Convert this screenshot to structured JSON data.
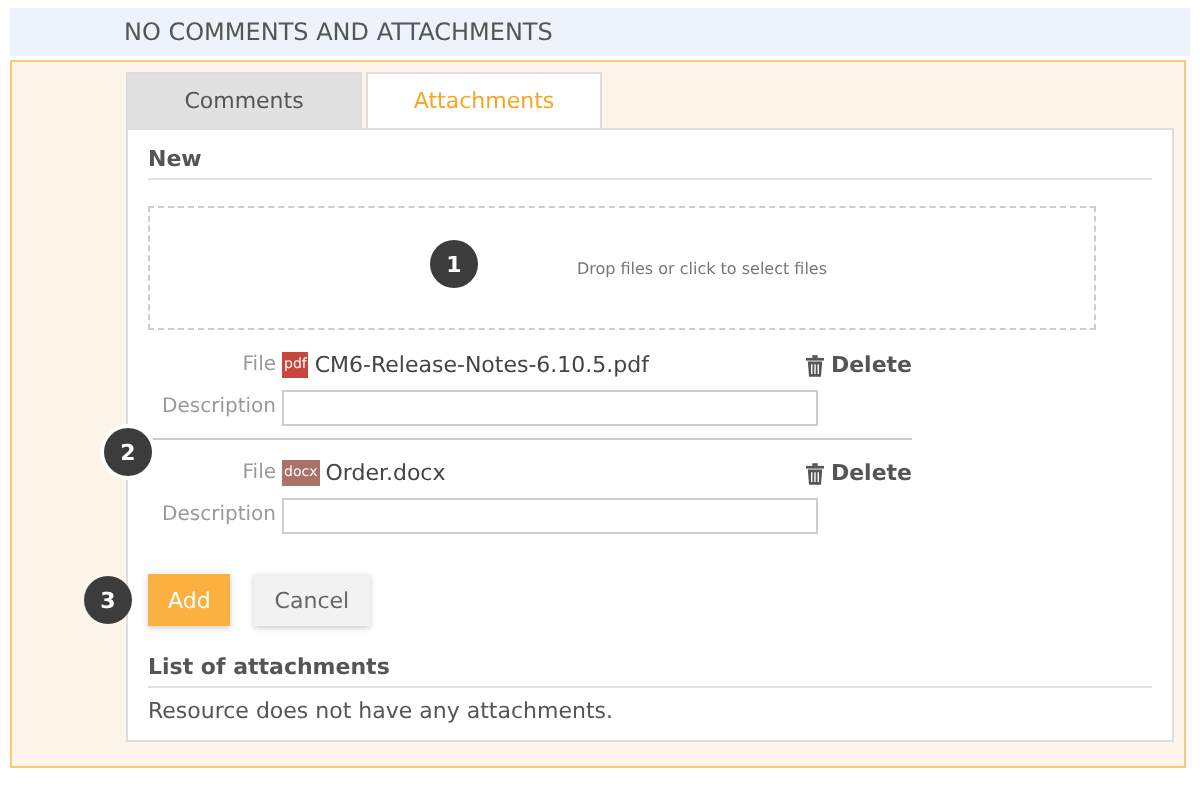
{
  "header": {
    "title": "NO COMMENTS AND ATTACHMENTS"
  },
  "tabs": [
    {
      "label": "Comments",
      "selected": false
    },
    {
      "label": "Attachments",
      "selected": true
    }
  ],
  "new_section": {
    "heading": "New",
    "dropzone": {
      "callout": "1",
      "text": "Drop files or click to select files"
    },
    "files_callout": "2",
    "files": [
      {
        "file_label": "File",
        "icon_label": "pdf",
        "color": "#c9463d",
        "name": "CM6-Release-Notes-6.10.5.pdf",
        "delete": "Delete",
        "description_label": "Description"
      },
      {
        "file_label": "File",
        "icon_label": "docx",
        "color": "#a87268",
        "name": "Order.docx",
        "delete": "Delete",
        "description_label": "Description"
      }
    ],
    "buttons_callout": "3",
    "buttons": [
      {
        "label": "Add",
        "kind": "primary"
      },
      {
        "label": "Cancel",
        "kind": "secondary"
      }
    ]
  },
  "list_section": {
    "heading": "List of attachments",
    "empty_text": "Resource does not have any attachments."
  }
}
